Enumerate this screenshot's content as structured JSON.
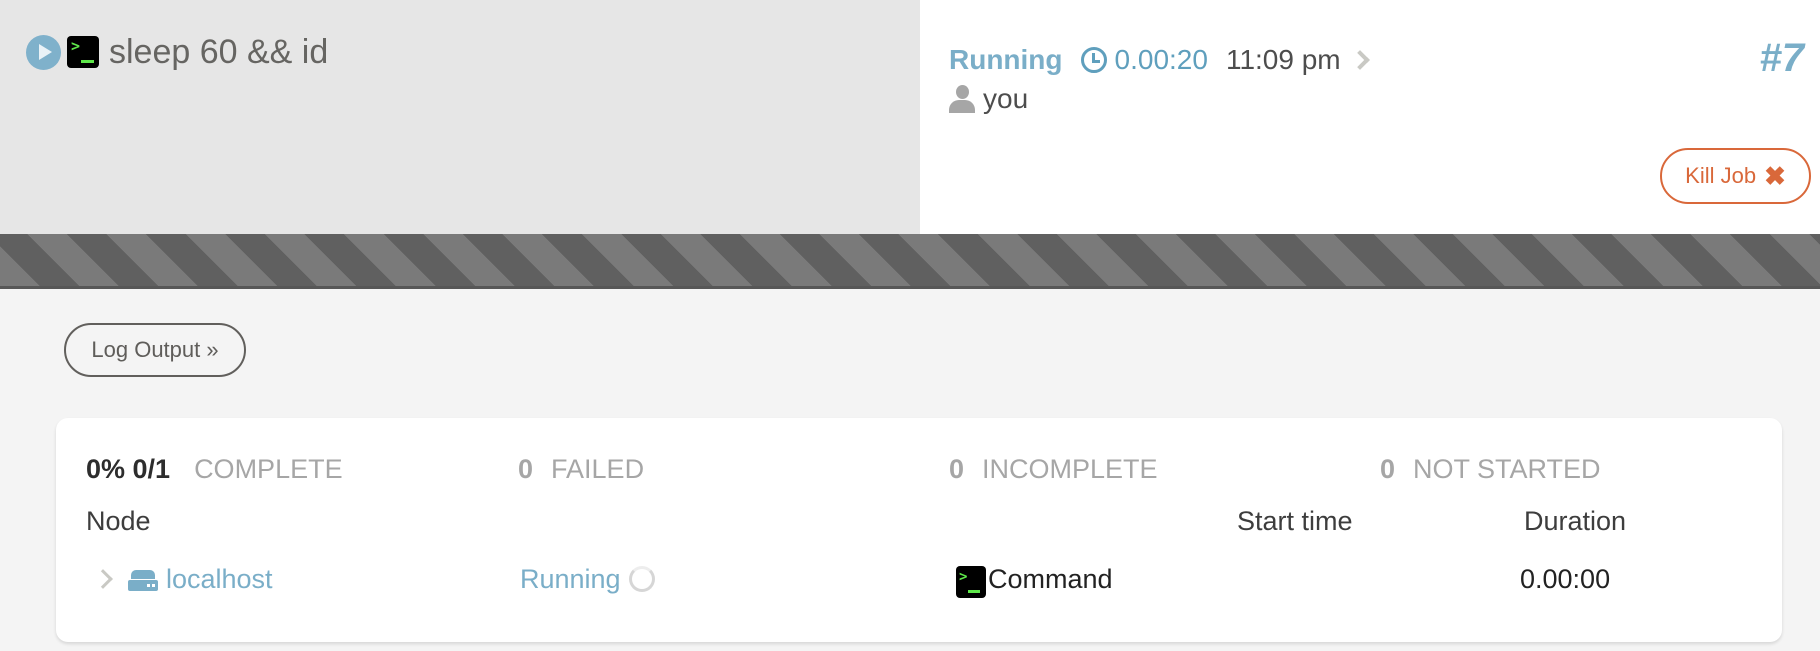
{
  "header": {
    "job_title": "sleep 60 && id",
    "status": "Running",
    "elapsed": "0.00:20",
    "start_time": "11:09 pm",
    "user": "you",
    "job_number": "#7",
    "kill_button_label": "Kill Job",
    "kill_icon": "✖"
  },
  "progress": {
    "percent": 0,
    "state": "running"
  },
  "toolbar": {
    "log_output_label": "Log Output »"
  },
  "summary": {
    "complete_percent": "0% 0/1",
    "complete_label": "COMPLETE",
    "failed_count": "0",
    "failed_label": "FAILED",
    "incomplete_count": "0",
    "incomplete_label": "INCOMPLETE",
    "not_started_count": "0",
    "not_started_label": "NOT STARTED"
  },
  "table": {
    "columns": {
      "node": "Node",
      "start_time": "Start time",
      "duration": "Duration"
    },
    "rows": [
      {
        "node": "localhost",
        "status": "Running",
        "step": "Command",
        "start_time": "",
        "duration": "0.00:00"
      }
    ]
  },
  "colors": {
    "accent": "#7aaec8",
    "danger": "#d9683a",
    "header_left_bg": "#e6e6e6"
  },
  "icons": {
    "terminal_prompt": ">"
  }
}
